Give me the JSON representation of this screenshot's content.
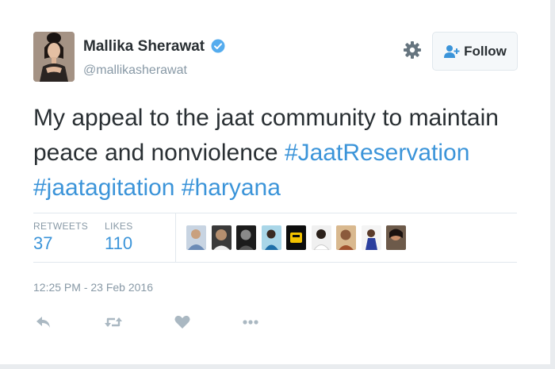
{
  "author": {
    "name": "Mallika Sherawat",
    "handle": "@mallikasherawat",
    "verified": true
  },
  "follow_button": {
    "label": "Follow"
  },
  "tweet": {
    "text_plain": "My appeal to the jaat community to maintain peace and nonviolence",
    "hashtags": [
      "#JaatReservation",
      "#jaatagitation",
      "#haryana"
    ]
  },
  "stats": {
    "retweets_label": "RETWEETS",
    "retweets_value": "37",
    "likes_label": "LIKES",
    "likes_value": "110"
  },
  "timestamp": "12:25 PM - 23 Feb 2016",
  "actions": [
    "reply-icon",
    "retweet-icon",
    "like-icon",
    "more-icon"
  ],
  "colors": {
    "text": "#292f33",
    "muted": "#8899a6",
    "link": "#3b94d9",
    "verified": "#55acee",
    "divider": "#e1e8ed"
  }
}
